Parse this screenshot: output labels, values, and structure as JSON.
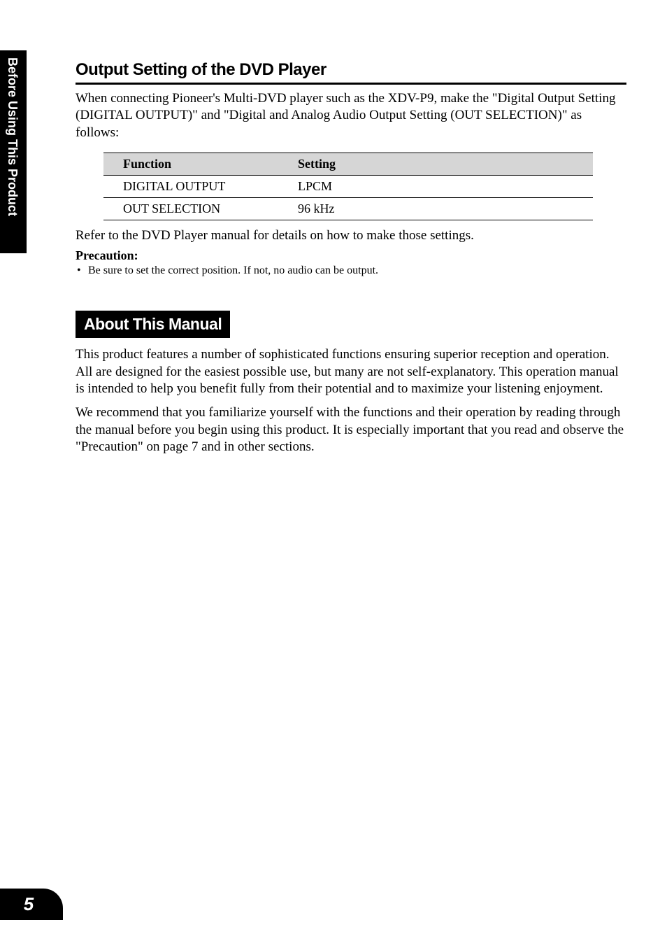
{
  "side_tab": {
    "label": "Before Using This Product"
  },
  "section1": {
    "title": "Output Setting of the DVD Player",
    "intro": "When connecting Pioneer's Multi-DVD player such as the XDV-P9, make the \"Digital Output Setting (DIGITAL OUTPUT)\" and \"Digital and Analog Audio Output Setting (OUT SELECTION)\" as follows:",
    "table": {
      "headers": {
        "function": "Function",
        "setting": "Setting"
      },
      "rows": [
        {
          "function": "DIGITAL OUTPUT",
          "setting": "LPCM"
        },
        {
          "function": "OUT SELECTION",
          "setting": "96 kHz"
        }
      ]
    },
    "refer_text": "Refer to the DVD Player manual for details on how to make those settings.",
    "precaution_label": "Precaution:",
    "precaution_bullet": "Be sure to set the correct position. If not, no audio can be output."
  },
  "section2": {
    "title": "About This Manual",
    "para1": "This product features a number of sophisticated functions ensuring superior reception and operation. All are designed for the easiest possible use, but many are not self-explanatory. This operation manual is intended to help you benefit fully from their potential and to maximize your listening enjoyment.",
    "para2": "We recommend that you familiarize yourself with the functions and their operation by reading through the manual before you begin using this product. It is especially important that you read and observe the \"Precaution\" on page 7 and in other sections."
  },
  "page_number": "5"
}
